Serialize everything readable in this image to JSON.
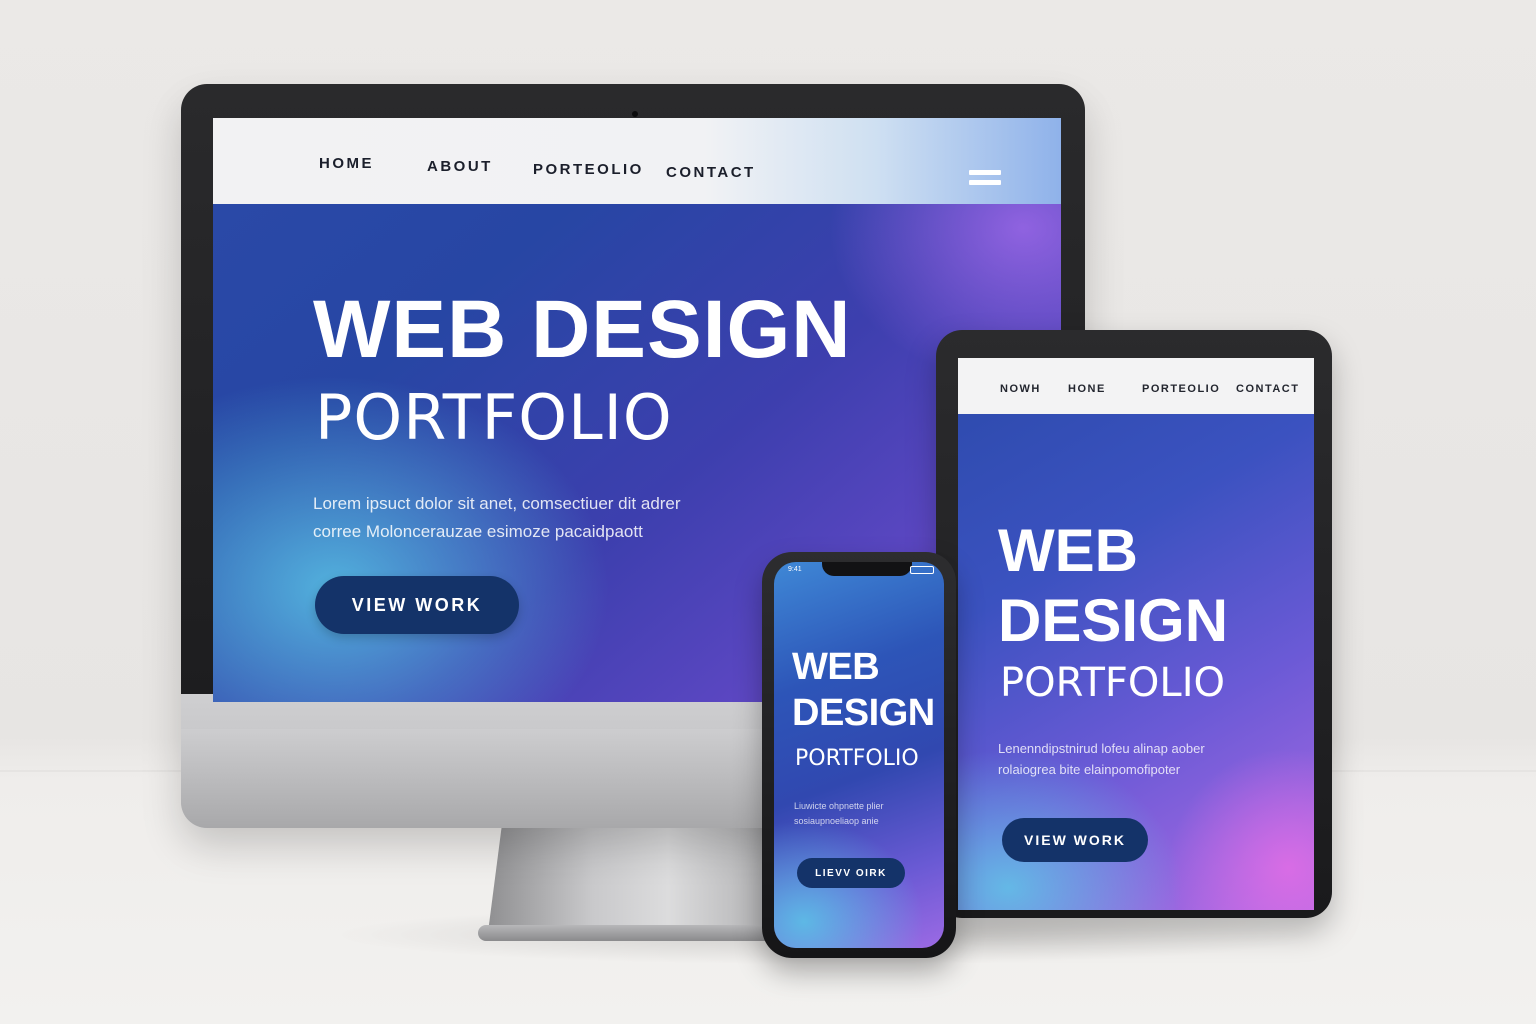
{
  "desktop": {
    "nav": {
      "items": [
        "HOME",
        "ABOUT",
        "PORTEOLIO",
        "CONTACT"
      ],
      "menu_icon": "hamburger-menu-icon"
    },
    "hero": {
      "title": "WEB DESIGN",
      "subtitle": "PORTFOLIO",
      "body_line1": "Lorem ipsuct dolor sit anet, comsectiuer dit adrer",
      "body_line2": "corree Moloncerauzae esimoze pacaidpaott",
      "button": "VIEW WORK"
    }
  },
  "tablet": {
    "nav": {
      "items": [
        "NOWH",
        "HONE",
        "PORTEOLIO",
        "CONTACT"
      ]
    },
    "hero": {
      "title_line1": "WEB",
      "title_line2": "DESIGN",
      "subtitle": "PORTFOLIO",
      "body_line1": "Lenenndipstnirud lofeu alinap aober",
      "body_line2": "rolaiogrea bite elainpomofipoter",
      "button": "VIEW WORK"
    }
  },
  "phone": {
    "status": {
      "time": "9:41",
      "battery_icon": "battery-icon"
    },
    "hero": {
      "title_line1": "WEB",
      "title_line2": "DESIGN",
      "subtitle": "PORTFOLIO",
      "body_line1": "Liuwicte ohpnette plier",
      "body_line2": "sosiaupnoeliaop anie",
      "button": "LIEVV OIRK"
    }
  },
  "colors": {
    "accent_blue": "#2746a4",
    "accent_purple": "#7a4fd6",
    "accent_cyan": "#58c4e6",
    "button_navy": "#143369"
  }
}
